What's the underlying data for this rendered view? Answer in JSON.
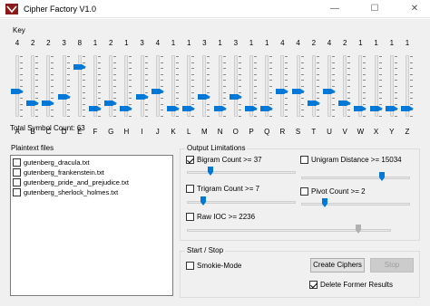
{
  "window": {
    "title": "Cipher Factory V1.0",
    "minimize": "—",
    "maximize": "☐",
    "close": "✕"
  },
  "key": {
    "label": "Key",
    "letters": [
      {
        "letter": "A",
        "count": "4",
        "level": 4
      },
      {
        "letter": "B",
        "count": "2",
        "level": 2
      },
      {
        "letter": "C",
        "count": "2",
        "level": 2
      },
      {
        "letter": "D",
        "count": "3",
        "level": 3
      },
      {
        "letter": "E",
        "count": "8",
        "level": 8
      },
      {
        "letter": "F",
        "count": "1",
        "level": 1
      },
      {
        "letter": "G",
        "count": "2",
        "level": 2
      },
      {
        "letter": "H",
        "count": "1",
        "level": 1
      },
      {
        "letter": "I",
        "count": "3",
        "level": 3
      },
      {
        "letter": "J",
        "count": "4",
        "level": 4
      },
      {
        "letter": "K",
        "count": "1",
        "level": 1
      },
      {
        "letter": "L",
        "count": "1",
        "level": 1
      },
      {
        "letter": "M",
        "count": "3",
        "level": 3
      },
      {
        "letter": "N",
        "count": "1",
        "level": 1
      },
      {
        "letter": "O",
        "count": "3",
        "level": 3
      },
      {
        "letter": "P",
        "count": "1",
        "level": 1
      },
      {
        "letter": "Q",
        "count": "1",
        "level": 1
      },
      {
        "letter": "R",
        "count": "4",
        "level": 4
      },
      {
        "letter": "S",
        "count": "4",
        "level": 4
      },
      {
        "letter": "T",
        "count": "2",
        "level": 2
      },
      {
        "letter": "U",
        "count": "4",
        "level": 4
      },
      {
        "letter": "V",
        "count": "2",
        "level": 2
      },
      {
        "letter": "W",
        "count": "1",
        "level": 1
      },
      {
        "letter": "X",
        "count": "1",
        "level": 1
      },
      {
        "letter": "Y",
        "count": "1",
        "level": 1
      },
      {
        "letter": "Z",
        "count": "1",
        "level": 1
      }
    ],
    "total_label": "Total Symbol Count: 63"
  },
  "plaintext": {
    "label": "Plaintext files",
    "files": [
      "gutenberg_dracula.txt",
      "gutenberg_frankenstein.txt",
      "gutenberg_pride_and_prejudice.txt",
      "gutenberg_sherlock_holmes.txt"
    ]
  },
  "output_limitations": {
    "label": "Output Limitations",
    "bigram": {
      "label": "Bigram Count >= 37",
      "checked": true,
      "level": 0.2
    },
    "unigram": {
      "label": "Unigram Distance >= 15034",
      "checked": false,
      "level": 0.75
    },
    "trigram": {
      "label": "Trigram Count >= 7",
      "checked": false,
      "level": 0.13
    },
    "pivot": {
      "label": "Pivot Count >= 2",
      "checked": false,
      "level": 0.2
    },
    "raw_ioc": {
      "label": "Raw IOC >= 2236",
      "checked": false,
      "level": 0.85
    }
  },
  "start_stop": {
    "label": "Start / Stop",
    "smokie_mode": {
      "label": "Smokie-Mode",
      "checked": false
    },
    "create_button": "Create Ciphers",
    "stop_button": "Stop",
    "delete_former": {
      "label": "Delete Former Results",
      "checked": true
    }
  },
  "colors": {
    "accent": "#0078d7",
    "title_icon": "#8b1a1a"
  }
}
